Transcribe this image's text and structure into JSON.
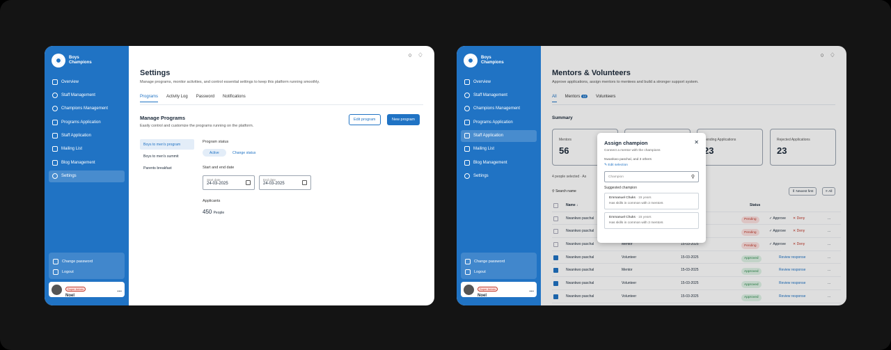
{
  "brand": {
    "name_line1": "Boys",
    "name_line2": "Champions"
  },
  "nav": [
    "Overview",
    "Staff Management",
    "Champions Management",
    "Programs Application",
    "Staff Application",
    "Mailing List",
    "Blog Management",
    "Settings"
  ],
  "account": {
    "change_password": "Change password",
    "logout": "Logout"
  },
  "user": {
    "role": "Super Admin",
    "name": "Noel",
    "menu": "..."
  },
  "settings": {
    "title": "Settings",
    "subtitle": "Manage programs, monitor activities, and control essential settings to keep this platform running smoothly.",
    "tabs": [
      "Programs",
      "Activity Log",
      "Password",
      "Notifications"
    ],
    "section_title": "Manage Programs",
    "section_sub": "Easily control and customize the programs running on the platform.",
    "edit_btn": "Edit program",
    "new_btn": "New program",
    "programs": [
      "Boys to men's program",
      "Boys to men's summit",
      "Parents breakfast"
    ],
    "status_label": "Program status",
    "status_value": "Active",
    "change_status": "Change status",
    "date_label": "Start and end date",
    "start_placeholder": "Start date",
    "start_value": "24-03-2025",
    "end_placeholder": "End date",
    "end_value": "24-03-2025",
    "applicants_label": "Applicants",
    "applicants_value": "450",
    "applicants_unit": "People"
  },
  "mentors": {
    "title": "Mentors & Volunteers",
    "subtitle": "Approve applications, assign mentors to mentees and build a stronger support system.",
    "tabs": {
      "all": "All",
      "mentors": "Mentors",
      "mentors_count": "12",
      "volunteers": "Volunteers"
    },
    "summary": "Summary",
    "cards": [
      {
        "label": "Mentors",
        "value": "56"
      },
      {
        "label": "",
        "value": ""
      },
      {
        "label": "Pending Applications",
        "value": "23"
      },
      {
        "label": "Rejected Applications",
        "value": "23"
      }
    ],
    "selected_text": "4 people selected",
    "selected_more": "As",
    "search": "Search name",
    "sort": "Newest first",
    "filter": "All",
    "col_name": "Name",
    "col_status": "Status",
    "rows": [
      {
        "name": "Nwankwo paschal",
        "role": "",
        "date": "",
        "status": "Pending",
        "checked": false,
        "approve": "Approve",
        "deny": "Deny"
      },
      {
        "name": "Nwankwo paschal",
        "role": "",
        "date": "2025",
        "status": "Pending",
        "checked": false,
        "approve": "Approve",
        "deny": "Deny"
      },
      {
        "name": "Nwankwo paschal",
        "role": "Mentor",
        "date": "15-03-2025",
        "status": "Pending",
        "checked": false,
        "approve": "Approve",
        "deny": "Deny"
      },
      {
        "name": "Nwankwo paschal",
        "role": "Volunteer",
        "date": "15-03-2025",
        "status": "Approved",
        "checked": true,
        "review": "Review response"
      },
      {
        "name": "Nwankwo paschal",
        "role": "Mentor",
        "date": "15-03-2025",
        "status": "Approved",
        "checked": true,
        "review": "Review response"
      },
      {
        "name": "Nwankwo paschal",
        "role": "Volunteer",
        "date": "15-03-2025",
        "status": "Approved",
        "checked": true,
        "review": "Review response"
      },
      {
        "name": "Nwankwo paschal",
        "role": "Volunteer",
        "date": "15-03-2025",
        "status": "Approved",
        "checked": true,
        "review": "Review response"
      }
    ],
    "row_menu": "..."
  },
  "modal": {
    "title": "Assign champion",
    "subtitle": "Connect a mentor with the champions",
    "names": "Nwankwo paschal, and 3 others",
    "edit": "Edit selection",
    "placeholder": "Champion",
    "suggested": "Suggested champion",
    "items": [
      {
        "name": "Emmanuel Chuks",
        "age": "15 years",
        "sub": "Has skills in common with 2 mentors"
      },
      {
        "name": "Emmanuel Chuks",
        "age": "15 years",
        "sub": "Has skills in common with 2 mentors"
      }
    ]
  },
  "colors": {
    "primary": "#2073c4",
    "pending": "#c0392b",
    "approved": "#2b8a4b"
  },
  "icons": [
    "search-icon",
    "bell-icon",
    "close-icon",
    "calendar-icon",
    "edit-icon",
    "check-icon",
    "x-icon"
  ]
}
